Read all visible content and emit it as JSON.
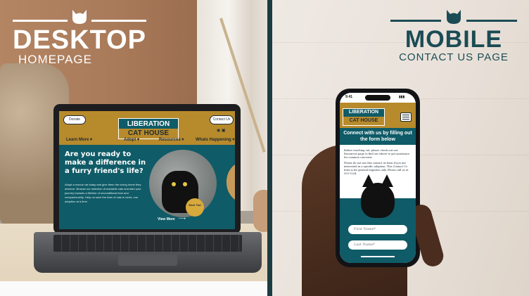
{
  "desktop": {
    "heading_big": "DESKTOP",
    "heading_small": "HOMEPAGE",
    "site": {
      "donate": "Donate",
      "contact": "Contact Us",
      "logo_line1": "LIBERATION",
      "logo_line2": "CAT HOUSE",
      "nav": [
        "Learn More",
        "Adopt",
        "Resources",
        "Whats Happening"
      ],
      "hero_title": "Are you ready to make a difference in a furry friend's life?",
      "hero_body": "Adopt a rescue cat today and give them the loving home they deserve. Browse our selection of adorable cats and start your journey towards a lifetime of unconditional love and companionship. Help us save the lives of cats in need, one adoption at a time.",
      "meet_label": "Meet Tod",
      "view_more": "View More"
    }
  },
  "mobile": {
    "heading_big": "MOBILE",
    "heading_small": "CONTACT US PAGE",
    "site": {
      "time": "9:41",
      "logo_line1": "LIBERATION",
      "logo_line2": "CAT HOUSE",
      "banner": "Connect with us by filling out the form below",
      "body_1": "Before reaching out, please check out our Resources page to find out where to get assistance for common concerns.",
      "body_2": "Please do not use this contact us form if you are interested in a specific adoption. This Contact Us form is for general inquiries only. Please call us at 555-1234.",
      "first_name": "First Name*",
      "last_name": "Last Name*"
    }
  },
  "colors": {
    "teal": "#0f5b67",
    "mustard": "#b78a2c",
    "dark_teal_heading": "#1b4c55"
  }
}
